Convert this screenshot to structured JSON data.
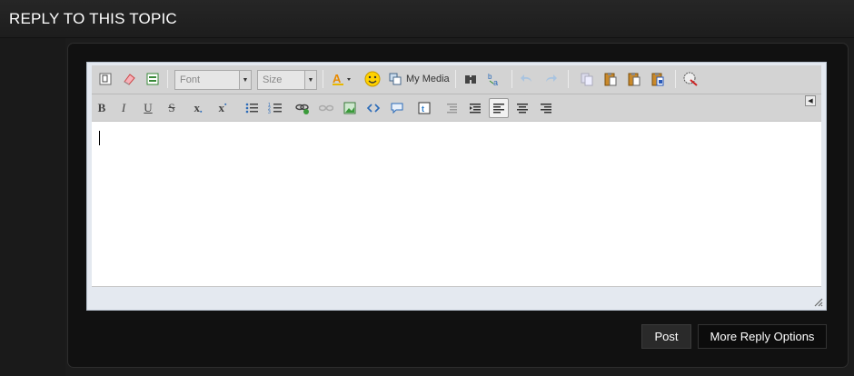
{
  "header": {
    "title": "REPLY TO THIS TOPIC"
  },
  "editor": {
    "toolbar_row1": {
      "font_label": "Font",
      "size_label": "Size",
      "my_media_label": "My Media"
    },
    "toolbar_row2": {
      "bold_glyph": "B",
      "italic_glyph": "I",
      "underline_glyph": "U",
      "strike_glyph": "S",
      "subscript_glyph": "x",
      "superscript_glyph": "x"
    }
  },
  "actions": {
    "post_label": "Post",
    "more_options_label": "More Reply Options"
  },
  "colors": {
    "page_bg": "#1c1c1c",
    "panel_bg": "#111111",
    "toolbar_bg": "#d3d3d3",
    "editor_frame": "#e4e9f0"
  }
}
